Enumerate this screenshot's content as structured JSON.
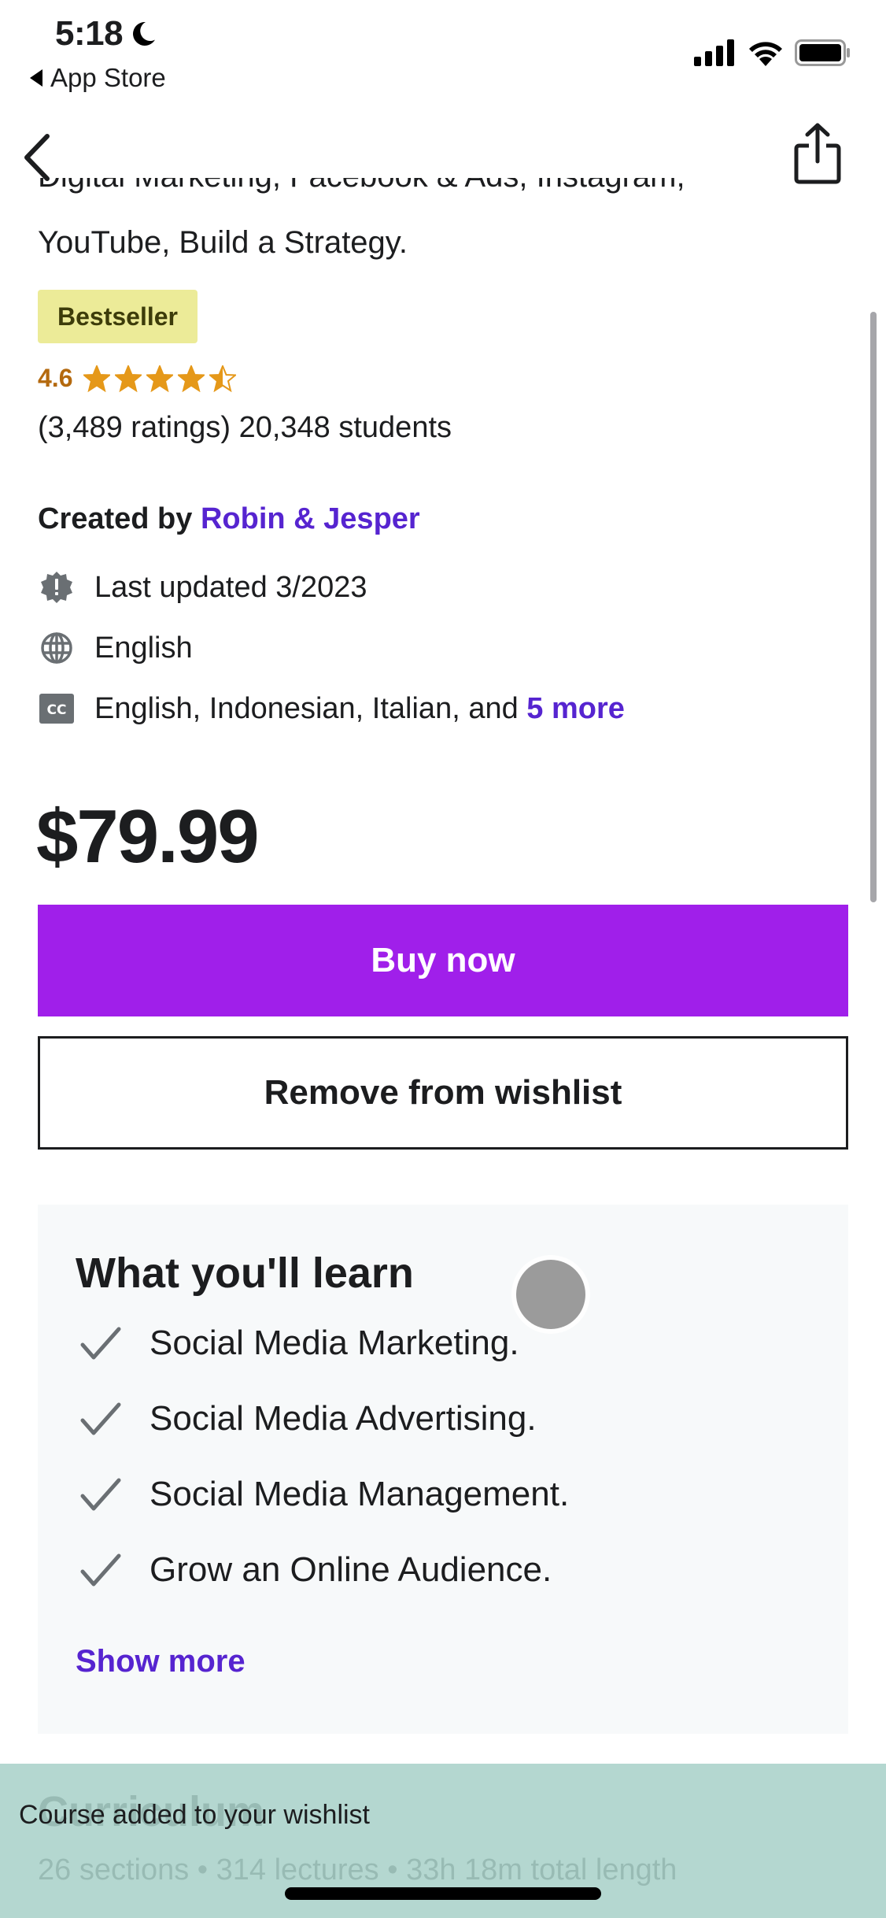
{
  "status_bar": {
    "time": "5:18",
    "focus_icon": "moon-icon",
    "back_app": "App Store",
    "icons": [
      "cellular-signal-icon",
      "wifi-icon",
      "battery-icon"
    ]
  },
  "nav": {
    "back_icon": "chevron-left-icon",
    "share_icon": "share-icon"
  },
  "course": {
    "subtitle_line1": "Digital Marketing, Facebook & Ads, Instagram,",
    "subtitle_line2": "YouTube, Build a Strategy.",
    "badge": "Bestseller",
    "rating": "4.6",
    "rating_value": 4.6,
    "rating_max": 5,
    "ratings_and_students": "(3,489 ratings) 20,348 students",
    "created_by_label": "Created by",
    "authors": "Robin & Jesper",
    "last_updated": "Last updated 3/2023",
    "language": "English",
    "captions_text": "English, Indonesian, Italian, and ",
    "captions_more": "5 more",
    "price": "$79.99"
  },
  "actions": {
    "buy_now": "Buy now",
    "remove_wishlist": "Remove from wishlist"
  },
  "learn": {
    "title": "What you'll learn",
    "items": [
      "Social Media Marketing.",
      "Social Media Advertising.",
      "Social Media Management.",
      "Grow an Online Audience."
    ],
    "show_more": "Show more"
  },
  "curriculum": {
    "title": "Curriculum",
    "summary": "26 sections • 314 lectures • 33h 18m total length"
  },
  "toast": {
    "message": "Course added to your wishlist"
  },
  "colors": {
    "primary_purple": "#a01fea",
    "link_purple": "#5624d0",
    "star_gold": "#e59819",
    "rating_orange": "#b4690e",
    "badge_bg": "#eceb98",
    "toast_bg": "#b4d8d2"
  }
}
